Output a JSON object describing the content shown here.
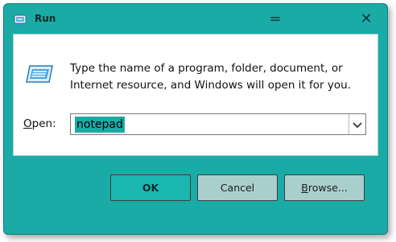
{
  "window": {
    "title": "Run",
    "minimize_glyph": "=",
    "close_glyph": "✕"
  },
  "body": {
    "description": "Type the name of a program, folder, document, or Internet resource, and Windows will open it for you.",
    "open_label_prefix": "O",
    "open_label_rest": "pen:",
    "open_value": "notepad"
  },
  "buttons": {
    "ok": "OK",
    "cancel": "Cancel",
    "browse_prefix": "B",
    "browse_rest": "rowse..."
  },
  "colors": {
    "accent": "#1aaba6",
    "ok_button": "#1bb7b1",
    "secondary_button": "#a9cfcd"
  },
  "icons": {
    "app": "run-icon",
    "dropdown": "chevron-down-icon"
  }
}
